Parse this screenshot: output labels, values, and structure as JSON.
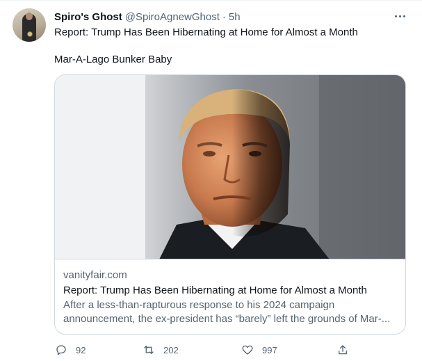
{
  "tweet": {
    "display_name": "Spiro's Ghost",
    "handle": "@SpiroAgnewGhost",
    "separator": "·",
    "time": "5h",
    "text_line1": "Report: Trump Has Been Hibernating at Home for Almost a Month",
    "text_line2": "Mar-A-Lago Bunker Baby"
  },
  "card": {
    "domain": "vanityfair.com",
    "title": "Report: Trump Has Been Hibernating at Home for Almost a Month",
    "description_line1": "After a less-than-rapturous response to his 2024 campaign",
    "description_line2": "announcement, the ex-president has “barely” left the grounds of Mar-..."
  },
  "actions": {
    "reply": {
      "icon": "reply-icon",
      "count": "92"
    },
    "retweet": {
      "icon": "retweet-icon",
      "count": "202"
    },
    "like": {
      "icon": "heart-icon",
      "count": "997"
    },
    "share": {
      "icon": "share-icon"
    }
  },
  "colors": {
    "text_primary": "#0f1419",
    "text_secondary": "#536471",
    "border": "#cfd9de"
  }
}
